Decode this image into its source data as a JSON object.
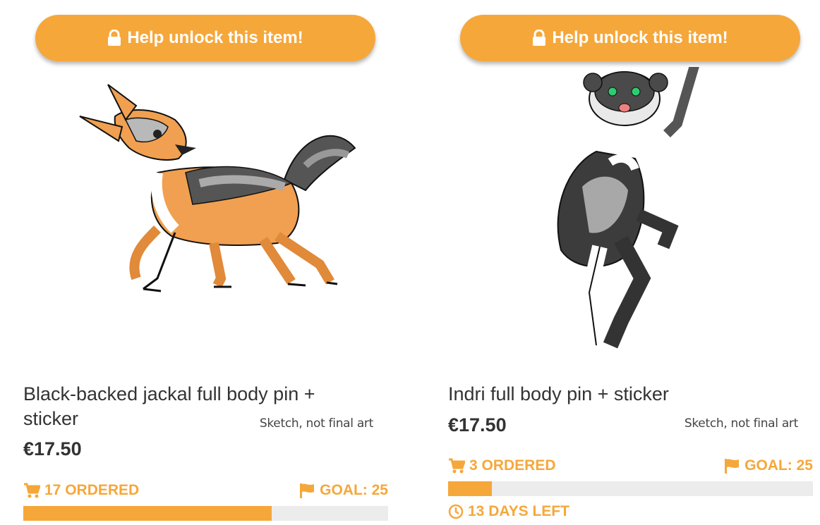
{
  "colors": {
    "accent": "#f6a73a",
    "track": "#ececec",
    "text": "#333333"
  },
  "cards": [
    {
      "unlock_label": "Help unlock this item!",
      "lock_icon": "lock-icon",
      "image_alt": "Black-backed jackal sketch",
      "sketch_note": "Sketch, not final art",
      "title": "Black-backed jackal full body pin + sticker",
      "price": "€17.50",
      "ordered": "17 ORDERED",
      "goal": "GOAL: 25",
      "progress_fraction": 0.68
    },
    {
      "unlock_label": "Help unlock this item!",
      "lock_icon": "lock-icon",
      "image_alt": "Indri sketch",
      "sketch_note": "Sketch, not final art",
      "title": "Indri full body pin + sticker",
      "price": "€17.50",
      "ordered": "3 ORDERED",
      "goal": "GOAL: 25",
      "progress_fraction": 0.12,
      "days_left": "13 DAYS LEFT"
    }
  ]
}
